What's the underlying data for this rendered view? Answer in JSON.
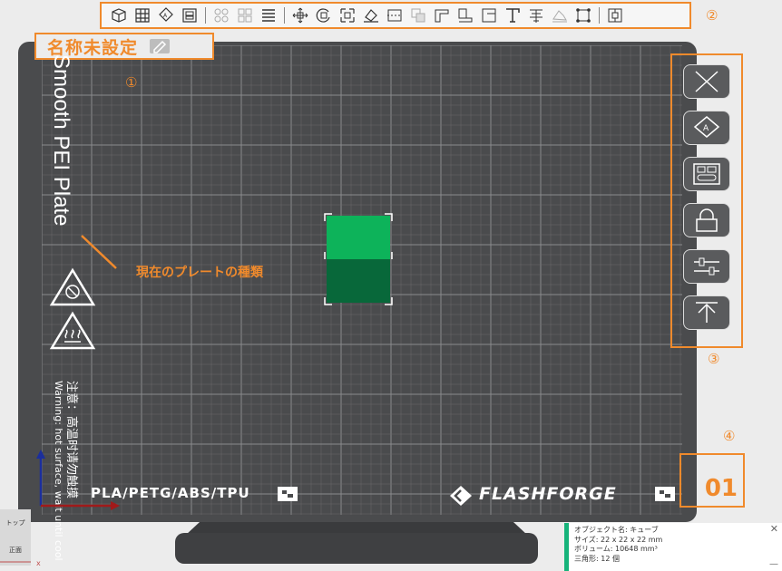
{
  "toolbar": {
    "icons": [
      "add-cube-icon",
      "arrange-icon",
      "plate-settings-icon",
      "layer-icon",
      "split-icon",
      "merge-icon",
      "layers-list-icon",
      "move-icon",
      "rotate-icon",
      "scale-icon",
      "lay-on-face-icon",
      "cut-icon",
      "boolean-icon",
      "support-paint-icon",
      "seam-paint-icon",
      "color-paint-icon",
      "text-icon",
      "variable-layer-icon",
      "assembly-icon",
      "measure-icon",
      "network-icon"
    ]
  },
  "plate": {
    "name": "名称未設定",
    "type": "Smooth PEI Plate",
    "filaments": "PLA/PETG/ABS/TPU",
    "brand": "FLASHFORGE",
    "number": "01",
    "warning_jp": "注意：高温时请勿触摸",
    "warning_en": "Warning: hot surface, wait until cool"
  },
  "annotations": {
    "n1": "①",
    "n2": "②",
    "n3": "③",
    "n4": "④",
    "plate_type_note": "現在のプレートの種類"
  },
  "right_panel": {
    "buttons": [
      "delete-plate",
      "auto-arrange",
      "plate-objects",
      "lock-plate",
      "plate-settings",
      "move-to-top"
    ]
  },
  "view_cube": {
    "top": "トップ",
    "front": "正面"
  },
  "object_info": {
    "name_line": "オブジェクト名: キューブ",
    "size_line": "サイズ: 22 x 22 x 22 mm",
    "volume_line": "ボリューム: 10648 mm³",
    "triangles_line": "三角形: 12 個"
  },
  "colors": {
    "accent": "#f08a2c",
    "plate": "#4a4b4d",
    "cube_top": "#0db35a",
    "cube_side": "#08683a",
    "info_accent": "#16b37a"
  }
}
